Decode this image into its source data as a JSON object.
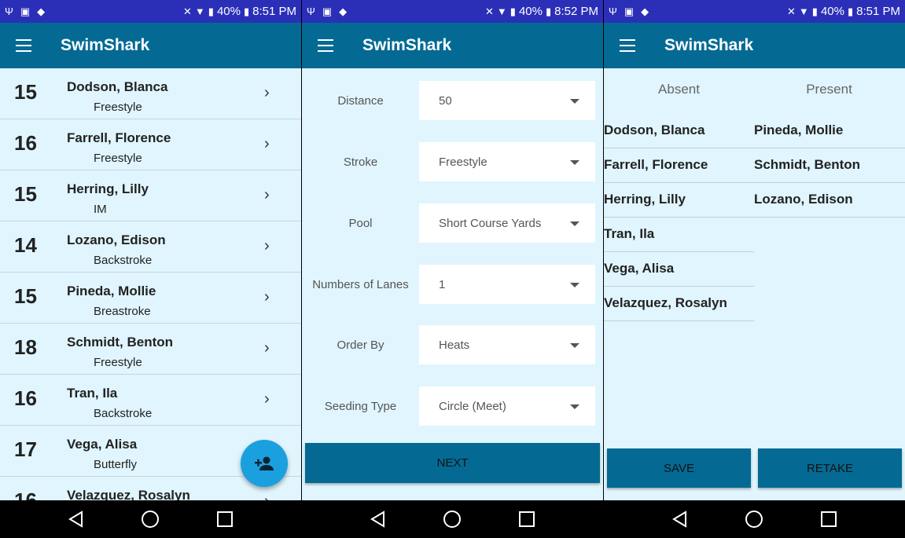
{
  "status_bars": [
    {
      "battery": "40%",
      "time": "8:51 PM"
    },
    {
      "battery": "40%",
      "time": "8:52 PM"
    },
    {
      "battery": "40%",
      "time": "8:51 PM"
    }
  ],
  "app": {
    "title": "SwimShark"
  },
  "roster": [
    {
      "age": "15",
      "name": "Dodson, Blanca",
      "stroke": "Freestyle"
    },
    {
      "age": "16",
      "name": "Farrell, Florence",
      "stroke": "Freestyle"
    },
    {
      "age": "15",
      "name": "Herring, Lilly",
      "stroke": "IM"
    },
    {
      "age": "14",
      "name": "Lozano, Edison",
      "stroke": "Backstroke"
    },
    {
      "age": "15",
      "name": "Pineda, Mollie",
      "stroke": "Breastroke"
    },
    {
      "age": "18",
      "name": "Schmidt, Benton",
      "stroke": "Freestyle"
    },
    {
      "age": "16",
      "name": "Tran, Ila",
      "stroke": "Backstroke"
    },
    {
      "age": "17",
      "name": "Vega, Alisa",
      "stroke": "Butterfly"
    },
    {
      "age": "16",
      "name": "Velazquez, Rosalyn",
      "stroke": ""
    }
  ],
  "form": {
    "fields": [
      {
        "label": "Distance",
        "value": "50"
      },
      {
        "label": "Stroke",
        "value": "Freestyle"
      },
      {
        "label": "Pool",
        "value": "Short Course Yards"
      },
      {
        "label": "Numbers of Lanes",
        "value": "1"
      },
      {
        "label": "Order By",
        "value": "Heats"
      },
      {
        "label": "Seeding Type",
        "value": "Circle (Meet)"
      }
    ],
    "next_label": "NEXT"
  },
  "attendance": {
    "absent_header": "Absent",
    "present_header": "Present",
    "absent": [
      "Dodson, Blanca",
      "Farrell, Florence",
      "Herring, Lilly",
      "Tran, Ila",
      "Vega, Alisa",
      "Velazquez, Rosalyn"
    ],
    "present": [
      "Pineda, Mollie",
      "Schmidt, Benton",
      "Lozano, Edison"
    ],
    "save_label": "SAVE",
    "retake_label": "RETAKE"
  },
  "colors": {
    "status_bar": "#2b2fb8",
    "app_bar": "#046a94",
    "background": "#e0f5fd",
    "fab": "#1aa0de"
  }
}
